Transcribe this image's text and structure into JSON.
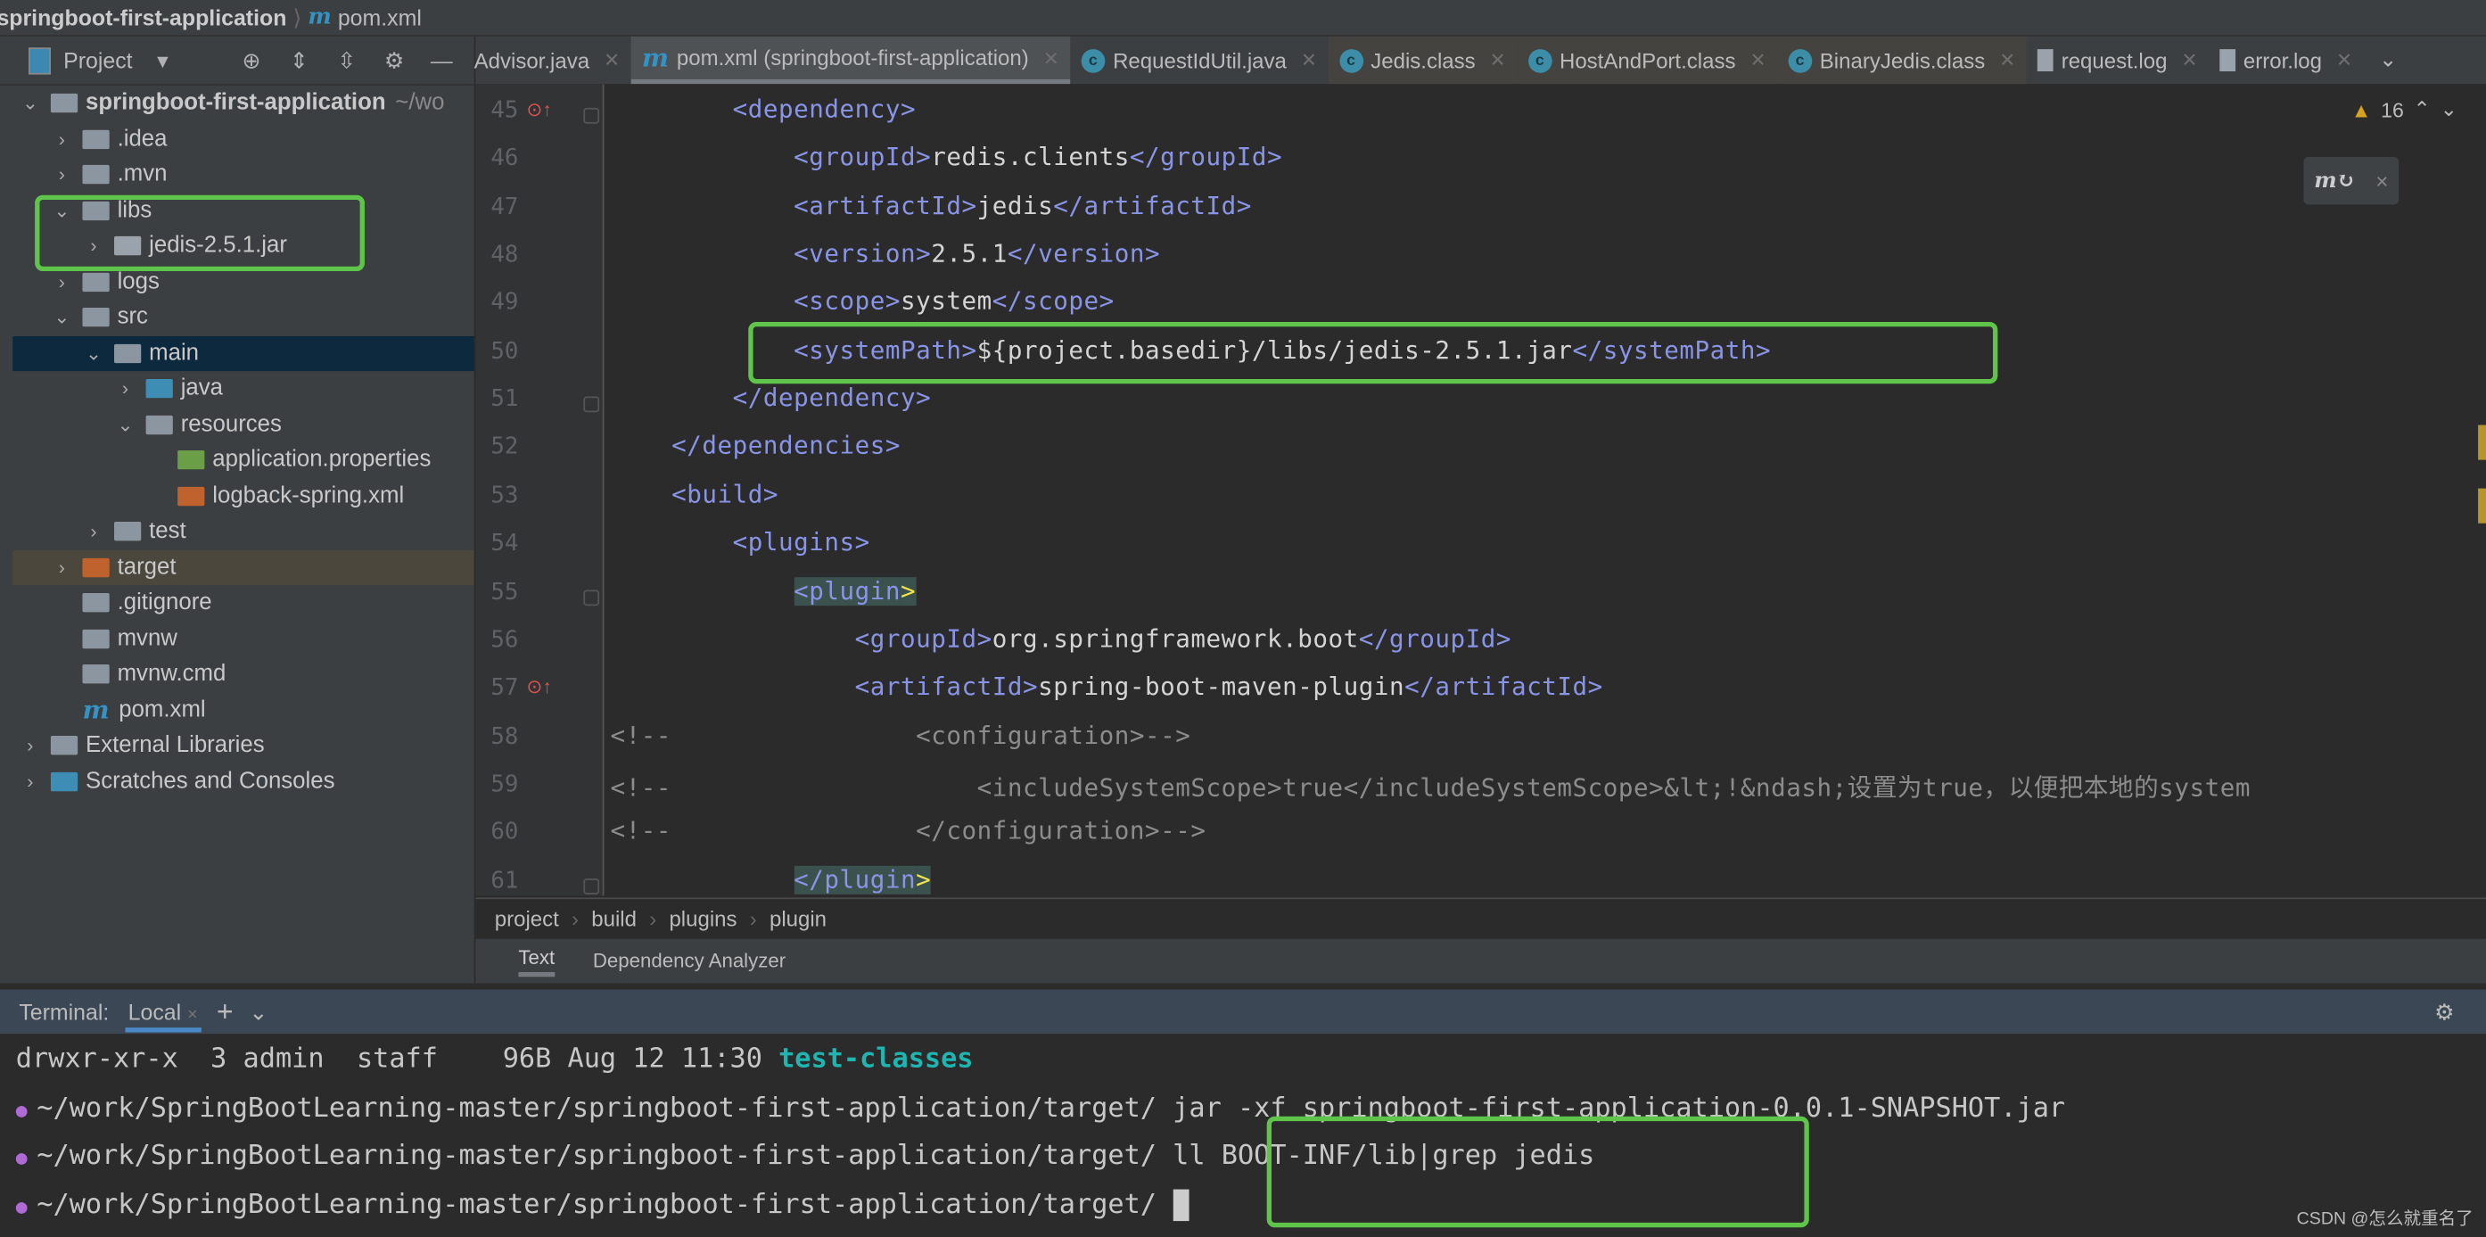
{
  "navbar": {
    "project": "springboot-first-application",
    "sep": "⟩",
    "file_icon": "m",
    "file": "pom.xml"
  },
  "sidebar": {
    "title": "Project",
    "tree": [
      {
        "label": "springboot-first-application",
        "suffix": "~/wo",
        "depth": 0,
        "chev": "v",
        "icon": "module",
        "bold": true
      },
      {
        "label": ".idea",
        "depth": 1,
        "chev": ">",
        "icon": "folder"
      },
      {
        "label": ".mvn",
        "depth": 1,
        "chev": ">",
        "icon": "folder"
      },
      {
        "label": "libs",
        "depth": 1,
        "chev": "v",
        "icon": "folder"
      },
      {
        "label": "jedis-2.5.1.jar",
        "depth": 2,
        "chev": ">",
        "icon": "jar"
      },
      {
        "label": "logs",
        "depth": 1,
        "chev": ">",
        "icon": "folder"
      },
      {
        "label": "src",
        "depth": 1,
        "chev": "v",
        "icon": "folder"
      },
      {
        "label": "main",
        "depth": 2,
        "chev": "v",
        "icon": "folder",
        "state": "selected"
      },
      {
        "label": "java",
        "depth": 3,
        "chev": ">",
        "icon": "source-folder"
      },
      {
        "label": "resources",
        "depth": 3,
        "chev": "v",
        "icon": "resources-folder"
      },
      {
        "label": "application.properties",
        "depth": 4,
        "chev": "",
        "icon": "spring-properties"
      },
      {
        "label": "logback-spring.xml",
        "depth": 4,
        "chev": "",
        "icon": "xml"
      },
      {
        "label": "test",
        "depth": 2,
        "chev": ">",
        "icon": "folder"
      },
      {
        "label": "target",
        "depth": 1,
        "chev": ">",
        "icon": "excluded-folder",
        "state": "excluded"
      },
      {
        "label": ".gitignore",
        "depth": 1,
        "chev": "",
        "icon": "gitignore"
      },
      {
        "label": "mvnw",
        "depth": 1,
        "chev": "",
        "icon": "shell"
      },
      {
        "label": "mvnw.cmd",
        "depth": 1,
        "chev": "",
        "icon": "text-file"
      },
      {
        "label": "pom.xml",
        "depth": 1,
        "chev": "",
        "icon": "maven"
      },
      {
        "label": "External Libraries",
        "depth": 0,
        "chev": ">",
        "icon": "libraries"
      },
      {
        "label": "Scratches and Consoles",
        "depth": 0,
        "chev": ">",
        "icon": "scratches"
      }
    ]
  },
  "tabs": [
    {
      "label": "Advisor.java",
      "icon": "",
      "state": ""
    },
    {
      "label": "pom.xml (springboot-first-application)",
      "icon": "maven",
      "state": "active"
    },
    {
      "label": "RequestIdUtil.java",
      "icon": "class",
      "state": ""
    },
    {
      "label": "Jedis.class",
      "icon": "class",
      "state": "group"
    },
    {
      "label": "HostAndPort.class",
      "icon": "class",
      "state": "group"
    },
    {
      "label": "BinaryJedis.class",
      "icon": "class",
      "state": "group"
    },
    {
      "label": "request.log",
      "icon": "log",
      "state": ""
    },
    {
      "label": "error.log",
      "icon": "log",
      "state": ""
    }
  ],
  "editor": {
    "warnings": "16",
    "warning_color": "#d7a21f",
    "lines": [
      {
        "n": "45",
        "mark": true,
        "tokens": [
          [
            "s",
            "        "
          ],
          [
            "tag",
            "<dependency>"
          ]
        ]
      },
      {
        "n": "46",
        "tokens": [
          [
            "s",
            "            "
          ],
          [
            "tag",
            "<groupId>"
          ],
          [
            "text",
            "redis.clients"
          ],
          [
            "tag",
            "</groupId>"
          ]
        ]
      },
      {
        "n": "47",
        "tokens": [
          [
            "s",
            "            "
          ],
          [
            "tag",
            "<artifactId>"
          ],
          [
            "text",
            "jedis"
          ],
          [
            "tag",
            "</artifactId>"
          ]
        ]
      },
      {
        "n": "48",
        "tokens": [
          [
            "s",
            "            "
          ],
          [
            "tag",
            "<version>"
          ],
          [
            "text",
            "2.5.1"
          ],
          [
            "tag",
            "</version>"
          ]
        ]
      },
      {
        "n": "49",
        "tokens": [
          [
            "s",
            "            "
          ],
          [
            "tag",
            "<scope>"
          ],
          [
            "text",
            "system"
          ],
          [
            "tag",
            "</scope>"
          ]
        ]
      },
      {
        "n": "50",
        "tokens": [
          [
            "s",
            "            "
          ],
          [
            "tag",
            "<systemPath>"
          ],
          [
            "text",
            "${project.basedir}/libs/jedis-2.5.1.jar"
          ],
          [
            "tag",
            "</systemPath>"
          ]
        ]
      },
      {
        "n": "51",
        "tokens": [
          [
            "s",
            "        "
          ],
          [
            "tag",
            "</dependency>"
          ]
        ]
      },
      {
        "n": "52",
        "tokens": [
          [
            "s",
            "    "
          ],
          [
            "tag",
            "</dependencies>"
          ]
        ]
      },
      {
        "n": "53",
        "tokens": [
          [
            "s",
            "    "
          ],
          [
            "tag",
            "<build>"
          ]
        ]
      },
      {
        "n": "54",
        "tokens": [
          [
            "s",
            "        "
          ],
          [
            "tag",
            "<plugins>"
          ]
        ]
      },
      {
        "n": "55",
        "tokens": [
          [
            "s",
            "            "
          ],
          [
            "hl",
            "<plugin"
          ],
          [
            "hly",
            ">"
          ]
        ]
      },
      {
        "n": "56",
        "tokens": [
          [
            "s",
            "                "
          ],
          [
            "tag",
            "<groupId>"
          ],
          [
            "text",
            "org.springframework.boot"
          ],
          [
            "tag",
            "</groupId>"
          ]
        ]
      },
      {
        "n": "57",
        "mark": true,
        "tokens": [
          [
            "s",
            "                "
          ],
          [
            "tag",
            "<artifactId>"
          ],
          [
            "text",
            "spring-boot-maven-plugin"
          ],
          [
            "tag",
            "</artifactId>"
          ]
        ]
      },
      {
        "n": "58",
        "tokens": [
          [
            "cm",
            "<!--                <configuration>-->"
          ]
        ]
      },
      {
        "n": "59",
        "tokens": [
          [
            "cm",
            "<!--                    <includeSystemScope>true</includeSystemScope>&lt;!&ndash;设置为true，以便把本地的system"
          ]
        ]
      },
      {
        "n": "60",
        "tokens": [
          [
            "cm",
            "<!--                </configuration>-->"
          ]
        ]
      },
      {
        "n": "61",
        "tokens": [
          [
            "s",
            "            "
          ],
          [
            "hl",
            "</plugin"
          ],
          [
            "hly",
            ">"
          ]
        ]
      }
    ]
  },
  "breadcrumb": [
    "project",
    "build",
    "plugins",
    "plugin"
  ],
  "subtabs": [
    "Text",
    "Dependency Analyzer"
  ],
  "terminal": {
    "title": "Terminal:",
    "tab": "Local",
    "lines": [
      {
        "prompt": false,
        "text": "drwxr-xr-x  3 admin  staff    96B Aug 12 11:30 ",
        "hl": "test-classes"
      },
      {
        "prompt": true,
        "text": "~/work/SpringBootLearning-master/springboot-first-application/target/ jar -xf springboot-first-application-0.0.1-SNAPSHOT.jar"
      },
      {
        "prompt": true,
        "text": "~/work/SpringBootLearning-master/springboot-first-application/target/ ll BOOT-INF/lib|grep jedis"
      },
      {
        "prompt": true,
        "text": "~/work/SpringBootLearning-master/springboot-first-application/target/ ",
        "cursor": true
      }
    ]
  },
  "watermark": "CSDN @怎么就重名了",
  "accent_highlight": "#5ec44a"
}
